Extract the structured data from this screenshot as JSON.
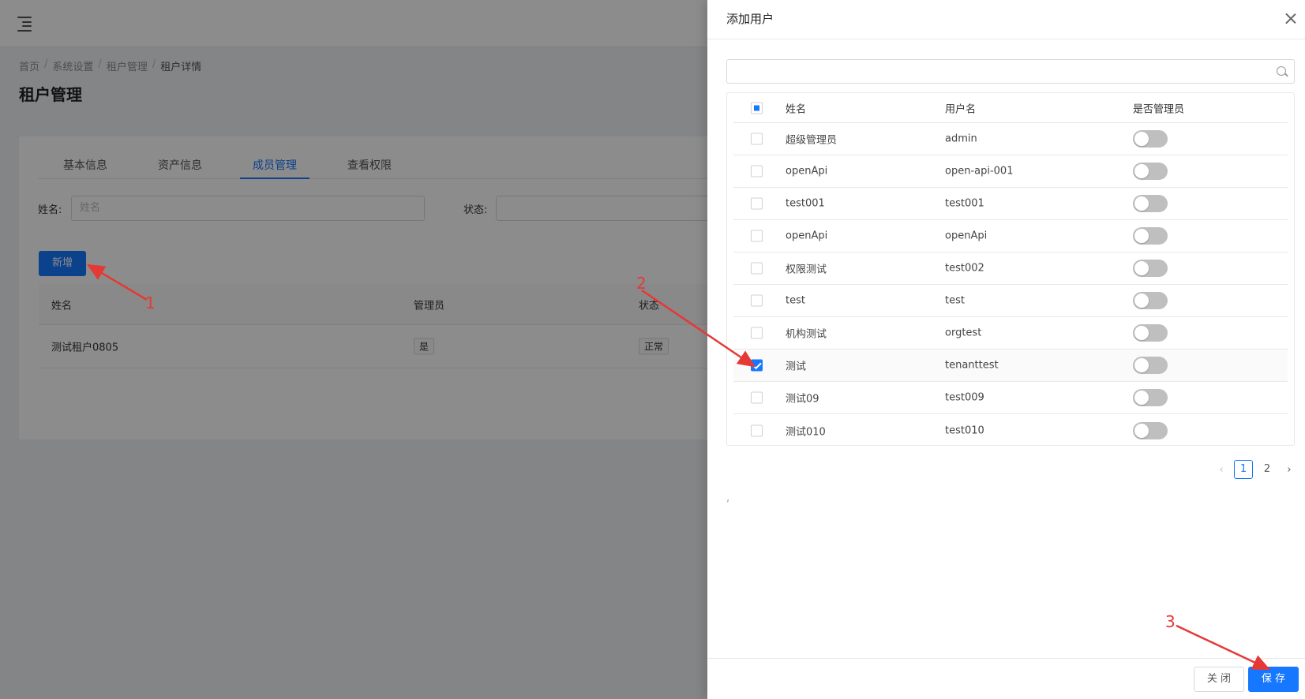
{
  "breadcrumb": [
    "首页",
    "系统设置",
    "租户管理",
    "租户详情"
  ],
  "breadcrumb_sep": "/",
  "page_title": "租户管理",
  "tabs": [
    {
      "label": "基本信息"
    },
    {
      "label": "资产信息"
    },
    {
      "label": "成员管理",
      "active": true
    },
    {
      "label": "查看权限"
    }
  ],
  "filters": {
    "name_label": "姓名:",
    "name_placeholder": "姓名",
    "status_label": "状态:"
  },
  "add_button": "新增",
  "member_table": {
    "columns": [
      "姓名",
      "管理员",
      "状态"
    ],
    "rows": [
      {
        "name": "测试租户0805",
        "admin": "是",
        "status": "正常"
      }
    ]
  },
  "drawer": {
    "title": "添加用户",
    "search_value": "",
    "columns": {
      "name": "姓名",
      "username": "用户名",
      "is_admin": "是否管理员"
    },
    "rows": [
      {
        "name": "超级管理员",
        "username": "admin",
        "checked": false,
        "is_admin": false
      },
      {
        "name": "openApi",
        "username": "open-api-001",
        "checked": false,
        "is_admin": false
      },
      {
        "name": "test001",
        "username": "test001",
        "checked": false,
        "is_admin": false
      },
      {
        "name": "openApi",
        "username": "openApi",
        "checked": false,
        "is_admin": false
      },
      {
        "name": "权限测试",
        "username": "test002",
        "checked": false,
        "is_admin": false
      },
      {
        "name": "test",
        "username": "test",
        "checked": false,
        "is_admin": false
      },
      {
        "name": "机构测试",
        "username": "orgtest",
        "checked": false,
        "is_admin": false
      },
      {
        "name": "测试",
        "username": "tenanttest",
        "checked": true,
        "is_admin": false
      },
      {
        "name": "测试09",
        "username": "test009",
        "checked": false,
        "is_admin": false
      },
      {
        "name": "测试010",
        "username": "test010",
        "checked": false,
        "is_admin": false
      }
    ],
    "pagination": {
      "pages": [
        "1",
        "2"
      ],
      "current": "1",
      "prev": "‹",
      "next": "›"
    },
    "stray_text": ",",
    "close_button": "关 闭",
    "save_button": "保 存"
  },
  "annotations": [
    "1",
    "2",
    "3"
  ],
  "colors": {
    "primary": "#1677ff",
    "annotation": "#e53935"
  }
}
